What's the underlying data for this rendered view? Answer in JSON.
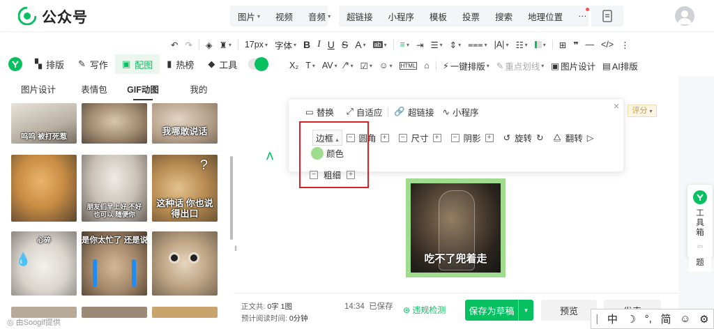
{
  "header": {
    "brand": "公众号",
    "menu_group1": [
      "图片",
      "视频",
      "音频"
    ],
    "menu_group2": [
      "超链接",
      "小程序",
      "模板",
      "投票",
      "搜索",
      "地理位置"
    ],
    "more": "···"
  },
  "toolbar1": {
    "font_size": "17px",
    "font_family": "字体"
  },
  "toolbar2": {
    "subscript": "X₂",
    "one_click": "一键排版",
    "underline_mark": "重点划线",
    "image_design": "图片设计",
    "ai_layout": "AI排版"
  },
  "tabs": [
    "排版",
    "写作",
    "配图",
    "热榜",
    "工具"
  ],
  "left_panel": {
    "subtabs": [
      "图片设计",
      "表情包",
      "GIF动图",
      "我的"
    ],
    "gifs": [
      {
        "caption": "呜呜 被打死惹"
      },
      {
        "caption": ""
      },
      {
        "caption": "我哪敢说话"
      },
      {
        "caption": ""
      },
      {
        "caption": "朋友们早上好 不好也可以 随便你"
      },
      {
        "caption": "这种话 你也说得出口"
      },
      {
        "caption": "心碎"
      },
      {
        "caption": "是你太忙了 还是说人太多了找不过来"
      },
      {
        "caption": ""
      }
    ],
    "credit": "由Soogif提供",
    "divider": "‖"
  },
  "popover": {
    "replace": "替换",
    "adapt": "自适应",
    "hyperlink": "超链接",
    "miniprogram": "小程序",
    "border": "边框",
    "corner": "圆角",
    "size": "尺寸",
    "shadow": "阴影",
    "rotate": "旋转",
    "flip": "翻转",
    "color": "颜色",
    "thickness": "粗细"
  },
  "editor": {
    "ranking": "评分",
    "image_caption": "吃不了兜着走"
  },
  "bottom_bar": {
    "body_label": "正文共:",
    "body_value": "0字 1图",
    "read_label": "预计阅读时间:",
    "read_value": "0分钟",
    "time": "14:34",
    "saved": "已保存",
    "check": "违规检测",
    "save_draft": "保存为草稿",
    "preview": "预览",
    "publish": "发表"
  },
  "right_rail": {
    "toolbox": "工具箱",
    "tool_chars": [
      "工",
      "具",
      "箱"
    ],
    "title_char": "题"
  },
  "ime": {
    "chinese": "中",
    "punct": "°,",
    "simplified": "简"
  },
  "colors": {
    "accent": "#07c160",
    "frame": "#9fdc8e",
    "highlight_box": "#e02020"
  }
}
